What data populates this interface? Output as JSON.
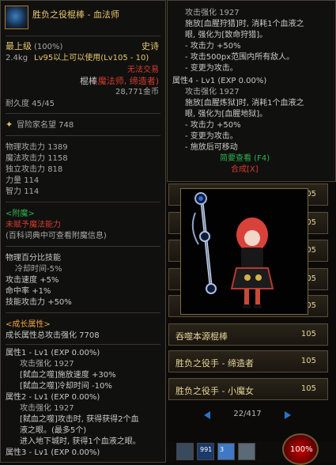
{
  "left_tooltip": {
    "item_name": "胜负之役棍棒 - 血法师",
    "grade": "最上级",
    "grade_percent": "(100%)",
    "rarity": "史诗",
    "weight": "2.4kg",
    "requirement": "Lv95以上可以使用(Lv105 - 10)",
    "type_prefix": "棍棒",
    "classes": "(魔法师, 缔造者)",
    "price": "28,771金币",
    "untradeable": "无法交易",
    "durability": "耐久度 45/45",
    "reputation": "冒险家名望 748",
    "stats": [
      {
        "name": "物理攻击力",
        "value": "1389"
      },
      {
        "name": "魔法攻击力",
        "value": "1158"
      },
      {
        "name": "独立攻击力",
        "value": "818"
      },
      {
        "name": "力量",
        "value": "114"
      },
      {
        "name": "智力",
        "value": "114"
      }
    ],
    "enchant_header": "<附魔>",
    "enchant_status": "未赋予魔法能力",
    "enchant_hint": "(百科词典中可查看附魔信息)",
    "skill_header": "物理百分比技能",
    "skill_cd": "冷却时间-5%",
    "mods": [
      {
        "name": "攻击速度",
        "value": "+5%"
      },
      {
        "name": "命中率",
        "value": "+1%"
      },
      {
        "name": "技能攻击力",
        "value": "+50%"
      }
    ],
    "growth_header": "<成长属性>",
    "growth_total": "成长属性总攻击强化 7708",
    "attr1": "属性1 - Lv1 (EXP 0.00%)",
    "attr1_atk": "攻击强化 1927",
    "attr1_l1": "[弑血之噬]施放速度 +30%",
    "attr1_l2": "[弑血之噬]冷却时间 -10%",
    "attr2": "属性2 - Lv1 (EXP 0.00%)",
    "attr2_atk": "攻击强化 1927",
    "attr2_l1": "[弑血之噬]攻击时, 获得获得2个血",
    "attr2_l2": "液之眼。(最多5个)",
    "attr2_l3": "进入地下城时, 获得1个血液之眼。",
    "attr3": "属性3 - Lv1 (EXP 0.00%)"
  },
  "right_tooltip": {
    "l1": "攻击强化 1927",
    "l2": "施放[血腥狩猎]时, 消耗1个血液之",
    "l3": "眼, 强化为[致命狩猎]。",
    "l4": "- 攻击力 +50%",
    "l5": "- 攻击500px范围内所有敌人。",
    "l6": "- 变更为攻击。",
    "attr4": "属性4 - Lv1 (EXP 0.00%)",
    "l7": "攻击强化 1927",
    "l8": "施放[血腥炼狱]时, 消耗1个血液之",
    "l9": "眼, 强化为[血腥地狱]。",
    "l10": "- 攻击力 +50%",
    "l11": "- 变更为攻击。",
    "l12": "- 施放后可移动",
    "brief_view": "简要查看 (F4)",
    "synthesize": "合成[X]"
  },
  "list": {
    "hidden_level": "105",
    "rows": [
      {
        "name": "吞噬本源棍棒",
        "level": "105"
      },
      {
        "name": "胜负之役手 - 缔造者",
        "level": "105"
      },
      {
        "name": "胜负之役手 - 小魔女",
        "level": "105"
      }
    ],
    "pager": "22/417"
  },
  "hud": {
    "hp_percent": "100%",
    "slot_count": "991",
    "hotkey": "3"
  },
  "colors": {
    "gold": "#e9c76a",
    "orange": "#f0a53a",
    "red": "#d23d2d",
    "green": "#2fb24b",
    "accent_blue": "#2a74c7"
  }
}
